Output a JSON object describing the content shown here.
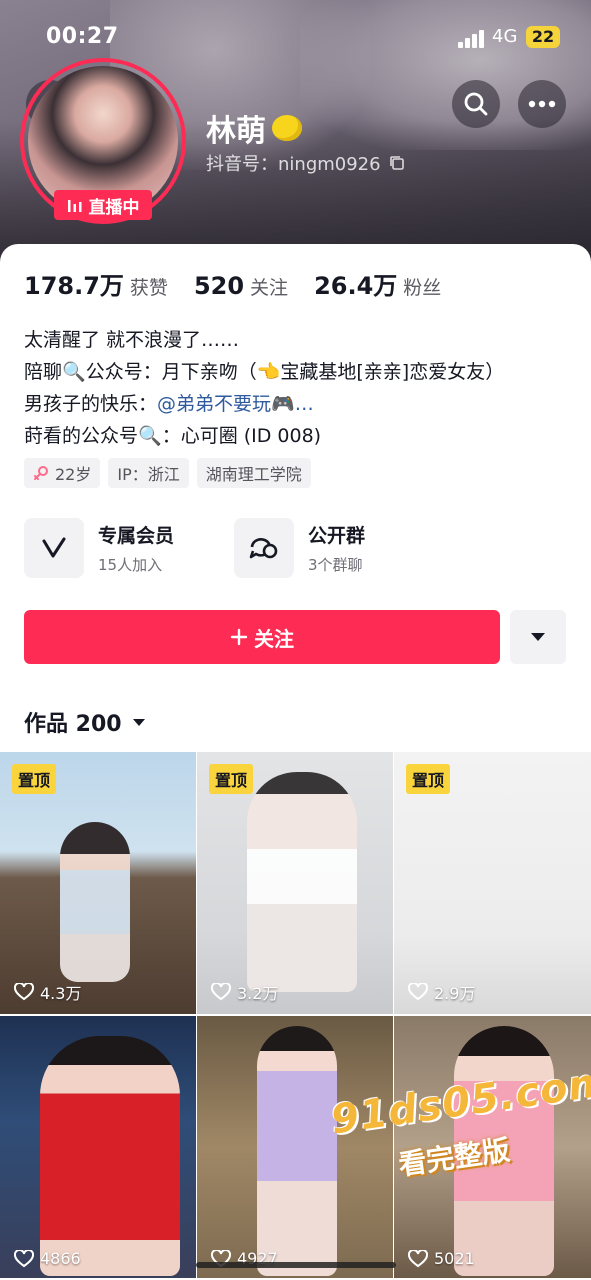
{
  "status_bar": {
    "time": "00:27",
    "network": "4G",
    "battery": "22"
  },
  "profile": {
    "nickname": "林萌",
    "douyin_id_label": "抖音号：ningm0926",
    "live_badge": "直播中"
  },
  "stats": [
    {
      "num": "178.7万",
      "label": "获赞"
    },
    {
      "num": "520",
      "label": "关注"
    },
    {
      "num": "26.4万",
      "label": "粉丝"
    }
  ],
  "bio": {
    "line1": "太清醒了 就不浪漫了……",
    "line2_prefix": "陪聊",
    "line2_rest": "公众号：月下亲吻（",
    "line2_tail": "宝藏基地[亲亲]恋爱女友）",
    "line3_prefix": "男孩子的快乐：",
    "line3_mention": "@弟弟不要玩",
    "line3_tail": "…",
    "line4_prefix": "莳看的公众号",
    "line4_rest": "：心可圈 (ID 008)"
  },
  "tags": [
    {
      "icon": "female-icon",
      "text": "22岁"
    },
    {
      "text": "IP：浙江"
    },
    {
      "text": "湖南理工学院"
    }
  ],
  "features": [
    {
      "icon": "vip-v-icon",
      "title": "专属会员",
      "sub": "15人加入"
    },
    {
      "icon": "group-chat-icon",
      "title": "公开群",
      "sub": "3个群聊"
    }
  ],
  "follow_label": "关注",
  "works_label": "作品 200",
  "grid": [
    {
      "pinned": "置顶",
      "likes": "4.3万"
    },
    {
      "pinned": "置顶",
      "likes": "3.2万"
    },
    {
      "pinned": "置顶",
      "likes": "2.9万"
    },
    {
      "likes": "4866"
    },
    {
      "likes": "4927"
    },
    {
      "likes": "5021"
    }
  ],
  "watermark": {
    "site": "91ds05.com",
    "sub": "看完整版"
  },
  "colors": {
    "accent": "#fe2c55",
    "pin": "#f9d43c",
    "mention": "#2f5a9e"
  }
}
